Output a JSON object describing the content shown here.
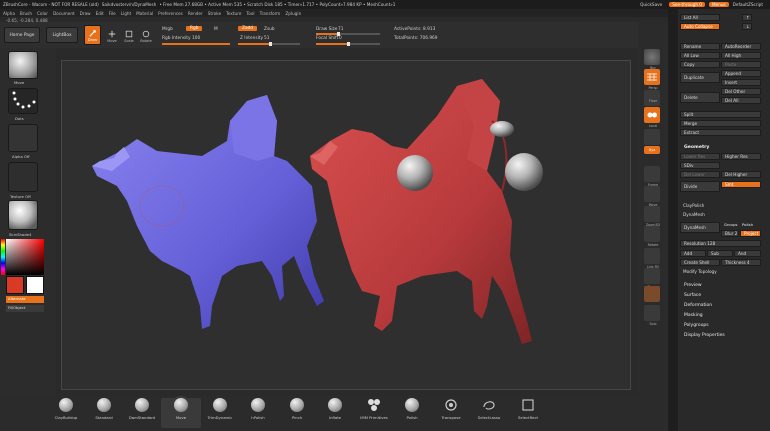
{
  "titlebar": {
    "left_text": [
      "ZBrushCore - Wacom - NOT FOR RESALE (old)",
      "Saikdvosterv/n/DynaMesh",
      "• Free Mem 27.68GB • Active Mem 535 • Scratch Disk 185 • Timer»1.717 • PolyCount»7.984 KP • MeshCount»1"
    ],
    "quicksave": "QuickSave",
    "seethrough": "See-through  0",
    "menus": "Menus",
    "defaultzscript": "DefaultZScript"
  },
  "menubar": [
    "Alpha",
    "Brush",
    "Color",
    "Document",
    "Draw",
    "Edit",
    "File",
    "Light",
    "Material",
    "Preferences",
    "Render",
    "Stroke",
    "Texture",
    "Tool",
    "Transform",
    "Zplugin"
  ],
  "coords": "-0.65, -0.284, 0.488",
  "toptool": {
    "home": "Home Page",
    "lightbox": "LightBox",
    "draw": "Draw",
    "modes": [
      "Move",
      "Scale",
      "Rotate"
    ],
    "mrgb": "Mrgb",
    "rgb": "Rgb",
    "m": "M",
    "rgb_intensity_label": "Rgb Intensity",
    "rgb_intensity": "100",
    "zadd": "Zadd",
    "zsub": "Zsub",
    "z_intensity_label": "Z Intensity",
    "z_intensity": "51",
    "draw_size_label": "Draw Size",
    "draw_size": "71",
    "focal_shift_label": "Focal Shift",
    "focal_shift": "0",
    "active_points": "ActivePoints: 8.913",
    "total_points": "TotalPoints: 706.969"
  },
  "leftshelf": {
    "brush": "Move",
    "stroke": "Dots",
    "alpha": "Alpha Off",
    "texture": "Texture Off",
    "material": "SkinShade4",
    "alternate": "Alternate",
    "fillobject": "FillObject",
    "colors": {
      "main": "#d93a25",
      "secondary": "#ffffff"
    }
  },
  "rightshelf": [
    "Bpr",
    "Persp",
    "Floor",
    "Local",
    "Xyz",
    "Frame",
    "Move",
    "Zoom3D",
    "Rotate",
    "Line Fill",
    "Transp",
    "Solo"
  ],
  "palette": {
    "listall": "List All",
    "autocollapse": "Auto Collapse",
    "subtool_buttons": [
      [
        "Rename",
        "AutoReorder"
      ],
      [
        "All Low",
        "All High"
      ],
      [
        "Copy",
        "Paste"
      ],
      [
        "",
        "Append"
      ],
      [
        "Duplicate",
        "Insert"
      ],
      [
        "",
        "Del Other"
      ],
      [
        "Delete",
        "Del All"
      ],
      [
        "Split",
        ""
      ],
      [
        "Merge",
        ""
      ],
      [
        "Extract",
        ""
      ]
    ],
    "geometry": "Geometry",
    "lower_res": "Lower Res",
    "higher_res": "Higher Res",
    "sdiv": "SDiv",
    "del_lower": "Del Lower",
    "del_higher": "Del Higher",
    "divide": "Divide",
    "smt": "Smt",
    "claypolish": "ClayPolish",
    "dynamesh_head": "DynaMesh",
    "dynamesh": "DynaMesh",
    "groups": "Groups",
    "polish": "Polish",
    "blur": "Blur 2",
    "project": "Project",
    "resolution": "Resolution 128",
    "add": "Add",
    "sub": "Sub",
    "and": "And",
    "create_shell": "Create Shell",
    "thickness": "Thickness 4",
    "modify_topology": "Modify Topology",
    "sections": [
      "Preview",
      "Surface",
      "Deformation",
      "Masking",
      "Polygroups",
      "Display Properties"
    ]
  },
  "bottom_brushes": [
    "ClayBuildup",
    "Standard",
    "DamStandard",
    "Move",
    "TrimDynamic",
    "hPolish",
    "Pinch",
    "Inflate",
    "IMM Primitives",
    "Polish",
    "Transpose",
    "SelectLasso",
    "SelectRect"
  ]
}
